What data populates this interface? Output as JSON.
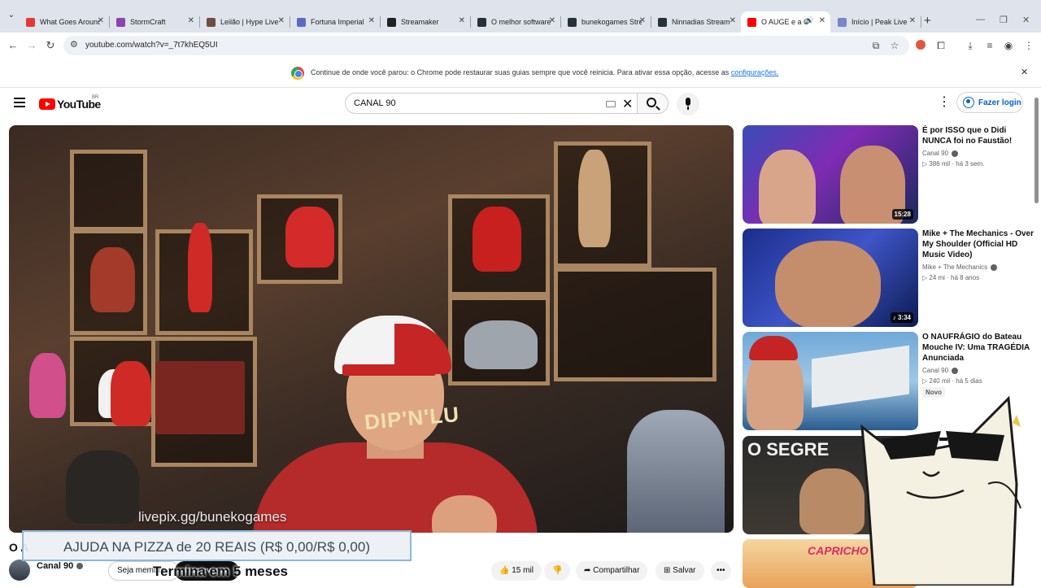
{
  "browser": {
    "tabs": [
      {
        "title": "What Goes Around",
        "color": "#e53935"
      },
      {
        "title": "StormCraft",
        "color": "#8e44ad"
      },
      {
        "title": "Leilão | Hype Live",
        "color": "#6d4c41"
      },
      {
        "title": "Fortuna Imperial",
        "color": "#5c6bc0"
      },
      {
        "title": "Streamaker",
        "color": "#212121"
      },
      {
        "title": "O melhor software",
        "color": "#263238"
      },
      {
        "title": "bunekogames Stream",
        "color": "#263238"
      },
      {
        "title": "Ninnadias Stream",
        "color": "#263238"
      },
      {
        "title": "O AUGE e a C",
        "color": "#ff0000"
      },
      {
        "title": "Início | Peak Live",
        "color": "#7986cb"
      }
    ],
    "url": "youtube.com/watch?v=_7t7khEQ5UI",
    "restore_bar": {
      "message": "Continue de onde você parou: o Chrome pode restaurar suas guias sempre que você reinicia. Para ativar essa opção, acesse as",
      "link": "configurações."
    }
  },
  "youtube": {
    "logo": "YouTube",
    "region": "BR",
    "search_query": "CANAL 90",
    "login_label": "Fazer login"
  },
  "video": {
    "overlay_url": "livepix.gg/bunekogames",
    "shirt_text": "DIP'N'LU",
    "title_fragment": "O A",
    "channel": "Canal 90",
    "join_label": "Seja membro",
    "subscribe_label": "Inscrever-se",
    "likes": "15 mil",
    "share_label": "Compartilhar",
    "save_label": "Salvar",
    "more_label": "•••"
  },
  "stream_overlay": {
    "donation": "AJUDA NA PIZZA de 20 REAIS (R$ 0,00/R$ 0,00)",
    "countdown": "Termina em 5 meses"
  },
  "recommendations": [
    {
      "title": "É por ISSO que o Didi NUNCA foi no Faustão!",
      "channel": "Canal 90",
      "verified": true,
      "views": "386 mil",
      "age": "há 3 sem.",
      "duration": "15:28",
      "badge": ""
    },
    {
      "title": "Mike + The Mechanics - Over My Shoulder (Official HD Music Video)",
      "channel": "Mike + The Mechanics",
      "verified": true,
      "views": "24 mi",
      "age": "há 8 anos",
      "duration": "3:34",
      "badge": ""
    },
    {
      "title": "O NAUFRÁGIO do Bateau Mouche IV: Uma TRAGÉDIA Anunciada",
      "channel": "Canal 90",
      "verified": true,
      "views": "240 mil",
      "age": "há 5 dias",
      "duration": "",
      "badge": "Novo"
    },
    {
      "title": "",
      "channel": "",
      "verified": false,
      "views": "",
      "age": "",
      "duration": "",
      "badge": "",
      "thumb_text": "O SEGRE"
    },
    {
      "title": "",
      "channel": "",
      "verified": false,
      "views": "",
      "age": "",
      "duration": "",
      "badge": "",
      "thumb_text": "CAPRICHO"
    }
  ],
  "colors": {
    "accent": "#065fd4",
    "youtube_red": "#ff0000",
    "chrome_link": "#1a73e8"
  }
}
